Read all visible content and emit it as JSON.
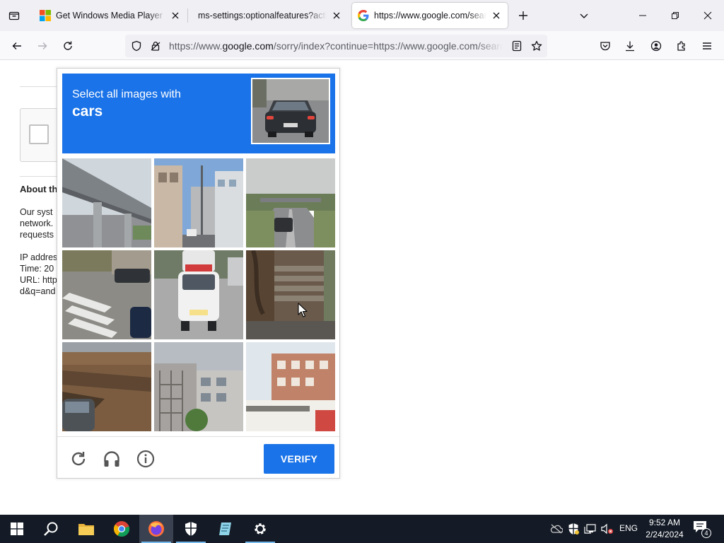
{
  "browser": {
    "tabs": [
      {
        "title": "Get Windows Media Player - Mi",
        "favicon": "microsoft-logo-icon",
        "active": false
      },
      {
        "title": "ms-settings:optionalfeatures?activat",
        "favicon": "none",
        "active": false
      },
      {
        "title": "https://www.google.com/searc",
        "favicon": "google-g-icon",
        "active": true
      }
    ],
    "url_prefix": "https://www.",
    "url_domain": "google.com",
    "url_rest": "/sorry/index?continue=https://www.google.com/searc"
  },
  "page": {
    "about_heading": "About th",
    "paragraph_lines": [
      "Our syst",
      "network.",
      "requests"
    ],
    "info_lines": [
      "IP addres",
      "Time: 20",
      "URL: http",
      "d&q=and"
    ]
  },
  "captcha": {
    "instruction": "Select all images with",
    "target": "cars",
    "verify_label": "VERIFY",
    "tiles": [
      "elevated-highway-overpass",
      "street-with-buildings-and-poles",
      "highway-with-car",
      "crosswalk-with-parked-cars",
      "white-car-on-street",
      "stone-steps-with-tree",
      "car-near-construction-site",
      "apartment-buildings-with-scaffolding",
      "brick-buildings-with-storefront"
    ]
  },
  "taskbar": {
    "apps": [
      "start-button",
      "search-button",
      "file-explorer",
      "chrome",
      "firefox",
      "windows-security",
      "notepad",
      "settings"
    ],
    "language": "ENG",
    "time": "9:52 AM",
    "date": "2/24/2024",
    "notification_count": "4"
  },
  "colors": {
    "captcha_blue": "#1a73e8",
    "taskbar_bg": "#141b26"
  }
}
